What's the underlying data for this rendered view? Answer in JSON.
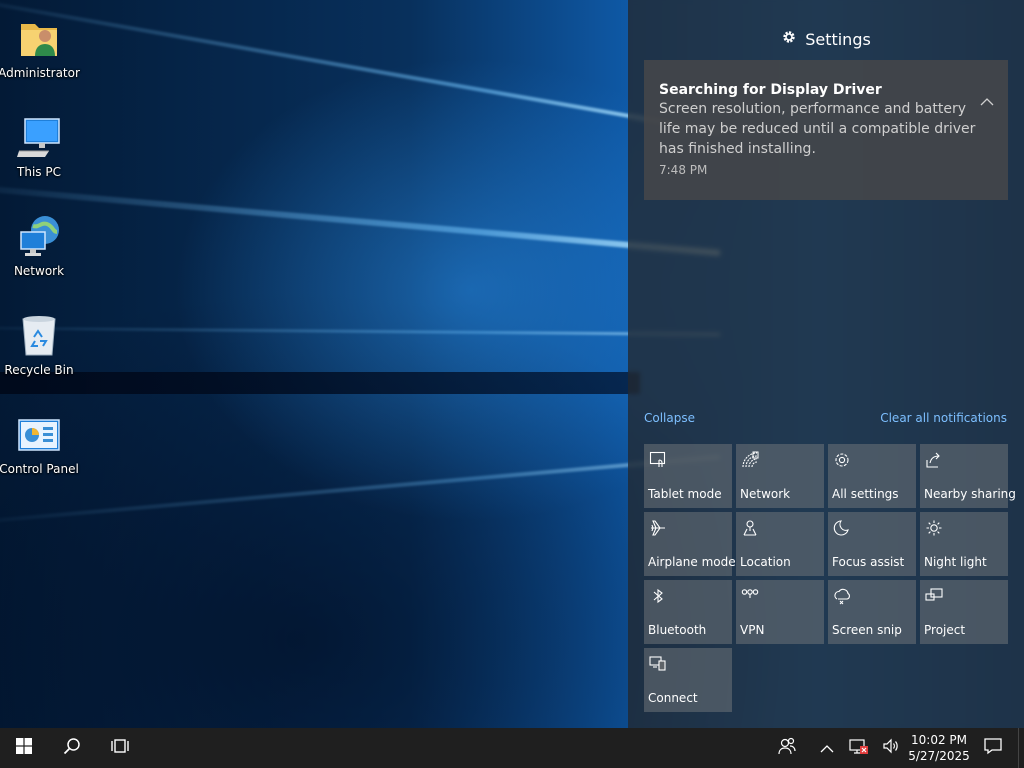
{
  "desktop": {
    "icons": [
      {
        "label": "Administrator",
        "icon": "user-folder-icon"
      },
      {
        "label": "This PC",
        "icon": "computer-icon"
      },
      {
        "label": "Network",
        "icon": "network-globe-icon"
      },
      {
        "label": "Recycle Bin",
        "icon": "recycle-bin-icon"
      },
      {
        "label": "Control Panel",
        "icon": "control-panel-icon"
      }
    ]
  },
  "action_center": {
    "header": {
      "title": "Settings",
      "icon": "gear-icon"
    },
    "notification": {
      "title": "Searching for Display Driver",
      "body": "Screen resolution, performance and battery life may be reduced until a compatible driver has finished installing.",
      "time": "7:48 PM"
    },
    "collapse_label": "Collapse",
    "clear_label": "Clear all notifications",
    "quick_actions": [
      {
        "label": "Tablet mode",
        "icon": "tablet-mode-icon"
      },
      {
        "label": "Network",
        "icon": "network-icon"
      },
      {
        "label": "All settings",
        "icon": "settings-gear-icon"
      },
      {
        "label": "Nearby sharing",
        "icon": "nearby-sharing-icon"
      },
      {
        "label": "Airplane mode",
        "icon": "airplane-icon"
      },
      {
        "label": "Location",
        "icon": "location-icon"
      },
      {
        "label": "Focus assist",
        "icon": "moon-icon"
      },
      {
        "label": "Night light",
        "icon": "sun-icon"
      },
      {
        "label": "Bluetooth",
        "icon": "bluetooth-icon"
      },
      {
        "label": "VPN",
        "icon": "vpn-icon"
      },
      {
        "label": "Screen snip",
        "icon": "screen-snip-icon"
      },
      {
        "label": "Project",
        "icon": "project-icon"
      },
      {
        "label": "Connect",
        "icon": "connect-icon"
      }
    ]
  },
  "taskbar": {
    "time": "10:02 PM",
    "date": "5/27/2025",
    "icons": [
      "start-icon",
      "search-icon",
      "task-view-icon",
      "people-icon",
      "chevron-up-icon",
      "network-disconnected-icon",
      "volume-icon",
      "notification-icon"
    ]
  },
  "colors": {
    "accent_link": "#7dbfff",
    "taskbar": "#1f1f1f",
    "tile": "#5f6469"
  }
}
